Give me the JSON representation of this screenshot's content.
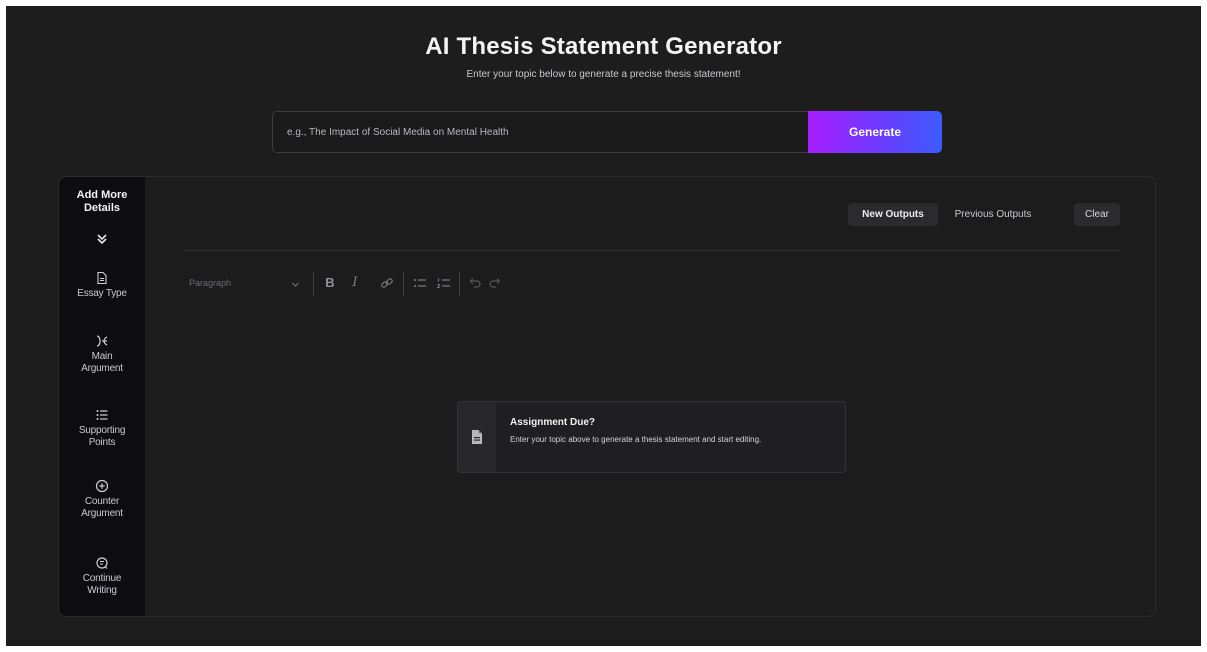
{
  "header": {
    "title": "AI Thesis Statement Generator",
    "subtitle": "Enter your topic below to generate a precise thesis statement!"
  },
  "topic_input": {
    "value": "",
    "placeholder": "e.g., The Impact of Social Media on Mental Health"
  },
  "generate_button": {
    "label": "Generate"
  },
  "sidebar": {
    "title_line1": "Add More",
    "title_line2": "Details",
    "collapse_icon": "double-chevron-down-icon",
    "items": [
      {
        "line1": "Essay Type",
        "line2": "",
        "icon": "document-icon"
      },
      {
        "line1": "Main",
        "line2": "Argument",
        "icon": "split-arrows-icon"
      },
      {
        "line1": "Supporting",
        "line2": "Points",
        "icon": "list-icon"
      },
      {
        "line1": "Counter",
        "line2": "Argument",
        "icon": "add-circle-icon"
      },
      {
        "line1": "Continue",
        "line2": "Writing",
        "icon": "continue-icon"
      }
    ]
  },
  "output_tabs": {
    "new_outputs": "New Outputs",
    "previous_outputs": "Previous Outputs",
    "clear": "Clear"
  },
  "editor_toolbar": {
    "format_select": "Paragraph",
    "bold": "B",
    "italic": "I"
  },
  "empty_state": {
    "title": "Assignment Due?",
    "text": "Enter your topic above to generate a thesis statement and start editing."
  },
  "colors": {
    "background": "#1d1d1e",
    "sidebar": "#0d0d11",
    "accent_start": "#a81fff",
    "accent_end": "#3c5bff"
  }
}
